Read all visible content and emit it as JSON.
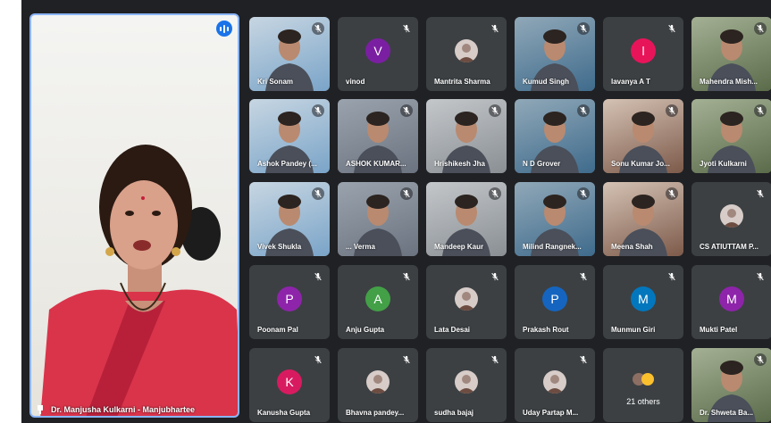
{
  "speaker": {
    "name": "Dr. Manjusha Kulkarni - Manjubhartee"
  },
  "colors": {
    "background": "#202124",
    "tile": "#3c4043",
    "speaking_border": "#8ab4f8"
  },
  "tiles": [
    {
      "label": "Kri Sonam",
      "kind": "video"
    },
    {
      "label": "vinod",
      "kind": "initial",
      "initial": "V",
      "color": "#7b1fa2"
    },
    {
      "label": "Mantrita Sharma",
      "kind": "photo"
    },
    {
      "label": "Kumud Singh",
      "kind": "video"
    },
    {
      "label": "lavanya A T",
      "kind": "initial",
      "initial": "l",
      "color": "#e8145a"
    },
    {
      "label": "Mahendra Mish...",
      "kind": "video"
    },
    {
      "label": "Ashok Pandey (...",
      "kind": "video"
    },
    {
      "label": "ASHOK KUMAR...",
      "kind": "video"
    },
    {
      "label": "Hrishikesh Jha",
      "kind": "video"
    },
    {
      "label": "N D Grover",
      "kind": "video"
    },
    {
      "label": "Sonu Kumar Jo...",
      "kind": "video"
    },
    {
      "label": "Jyoti Kulkarni",
      "kind": "video"
    },
    {
      "label": "Vivek Shukla",
      "kind": "video"
    },
    {
      "label": "... Verma",
      "kind": "video"
    },
    {
      "label": "Mandeep Kaur",
      "kind": "video"
    },
    {
      "label": "Milind Rangnek...",
      "kind": "video"
    },
    {
      "label": "Meena Shah",
      "kind": "video"
    },
    {
      "label": "CS ATIUTTAM P...",
      "kind": "photo"
    },
    {
      "label": "Poonam Pal",
      "kind": "initial",
      "initial": "P",
      "color": "#8e24aa"
    },
    {
      "label": "Anju Gupta",
      "kind": "initial",
      "initial": "A",
      "color": "#43a047"
    },
    {
      "label": "Lata Desai",
      "kind": "photo"
    },
    {
      "label": "Prakash Rout",
      "kind": "initial",
      "initial": "P",
      "color": "#1565c0"
    },
    {
      "label": "Munmun Giri",
      "kind": "initial",
      "initial": "M",
      "color": "#0277bd"
    },
    {
      "label": "Mukti Patel",
      "kind": "initial",
      "initial": "M",
      "color": "#8e24aa"
    },
    {
      "label": "Kanusha Gupta",
      "kind": "initial",
      "initial": "K",
      "color": "#d81b60"
    },
    {
      "label": "Bhavna pandey...",
      "kind": "photo"
    },
    {
      "label": "sudha bajaj",
      "kind": "photo"
    },
    {
      "label": "Uday Partap M...",
      "kind": "photo"
    },
    {
      "label": "21 others",
      "kind": "others"
    },
    {
      "label": "Dr. Shweta Ba...",
      "kind": "video"
    }
  ]
}
